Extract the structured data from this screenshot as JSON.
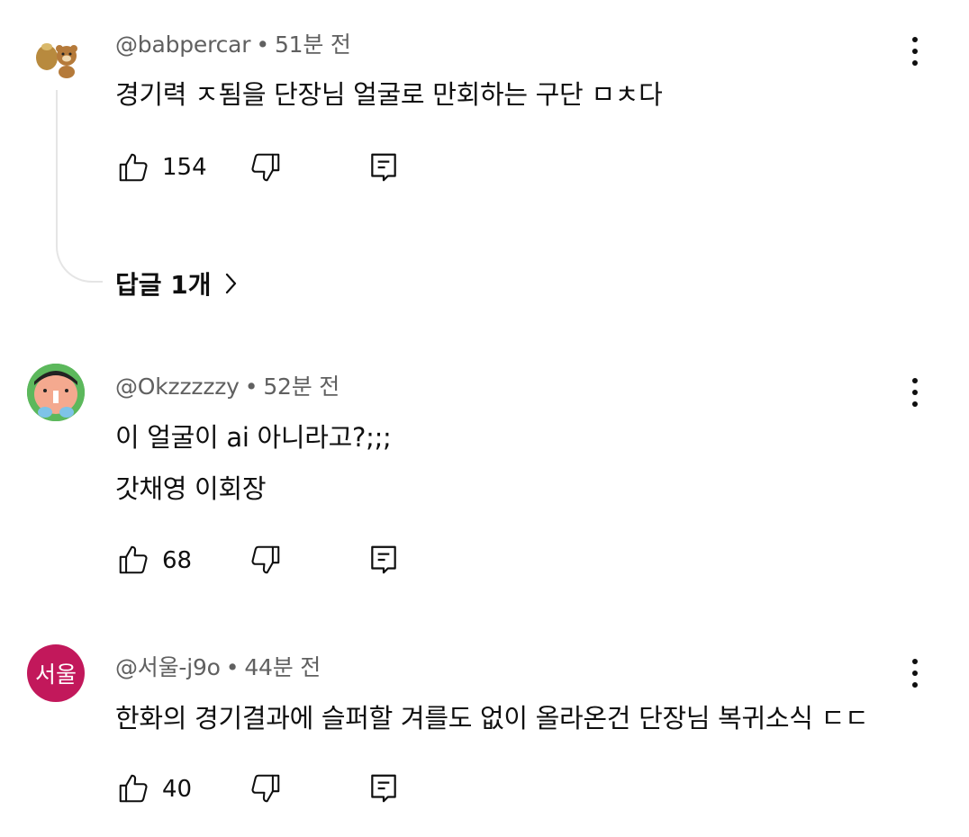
{
  "comments": [
    {
      "handle": "@babpercar",
      "time": "51분 전",
      "lines": [
        "경기력 ㅈ됨을 단장님 얼굴로 만회하는 구단 ㅁㅊ다"
      ],
      "likes": "154",
      "replies_label": "답글 1개"
    },
    {
      "handle": "@Okzzzzzy",
      "time": "52분 전",
      "lines": [
        "이 얼굴이 ai 아니라고?;;;",
        "갓채영 이회장"
      ],
      "likes": "68"
    },
    {
      "handle": "@서울-j9o",
      "time": "44분 전",
      "avatar_text": "서울",
      "avatar_color": "#c2185b",
      "lines": [
        "한화의 경기결과에 슬퍼할 겨를도 없이 올라온건 단장님 복귀소식 ㄷㄷ"
      ],
      "likes": "40"
    }
  ],
  "separator": "•",
  "icons": [
    "like-icon",
    "dislike-icon",
    "reply-icon",
    "more-vert-icon",
    "chevron-right-icon"
  ]
}
